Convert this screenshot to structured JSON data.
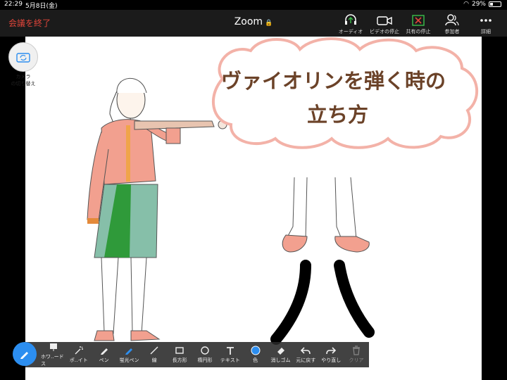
{
  "status": {
    "time": "22:29",
    "date": "5月8日(金)",
    "battery": "29%"
  },
  "meeting": {
    "end_label": "会議を終了",
    "title": "Zoom"
  },
  "toolbar": {
    "audio": "オーディオ",
    "video_stop": "ビデオの停止",
    "share_stop": "共有の停止",
    "participants": "参加者",
    "more": "詳細"
  },
  "camera": {
    "switch_label_1": "カメラ",
    "switch_label_2": "の切り替え"
  },
  "slide": {
    "heading_line1": "ヴァイオリンを弾く時の",
    "heading_line2": "立ち方"
  },
  "annotate": {
    "whiteboard": "ホワ‥ードス",
    "spotlight": "ポ‥イト",
    "pen": "ペン",
    "highlighter": "蛍光ペン",
    "line": "線",
    "rectangle": "長方形",
    "ellipse": "楕円形",
    "text": "テキスト",
    "color": "色",
    "eraser": "消しゴム",
    "undo": "元に戻す",
    "redo": "やり直し",
    "clear": "クリア"
  },
  "colors": {
    "accent": "#2c8ef0",
    "end": "#e0453a",
    "share_icon": "#3bbf4a",
    "heading": "#6b4228"
  }
}
